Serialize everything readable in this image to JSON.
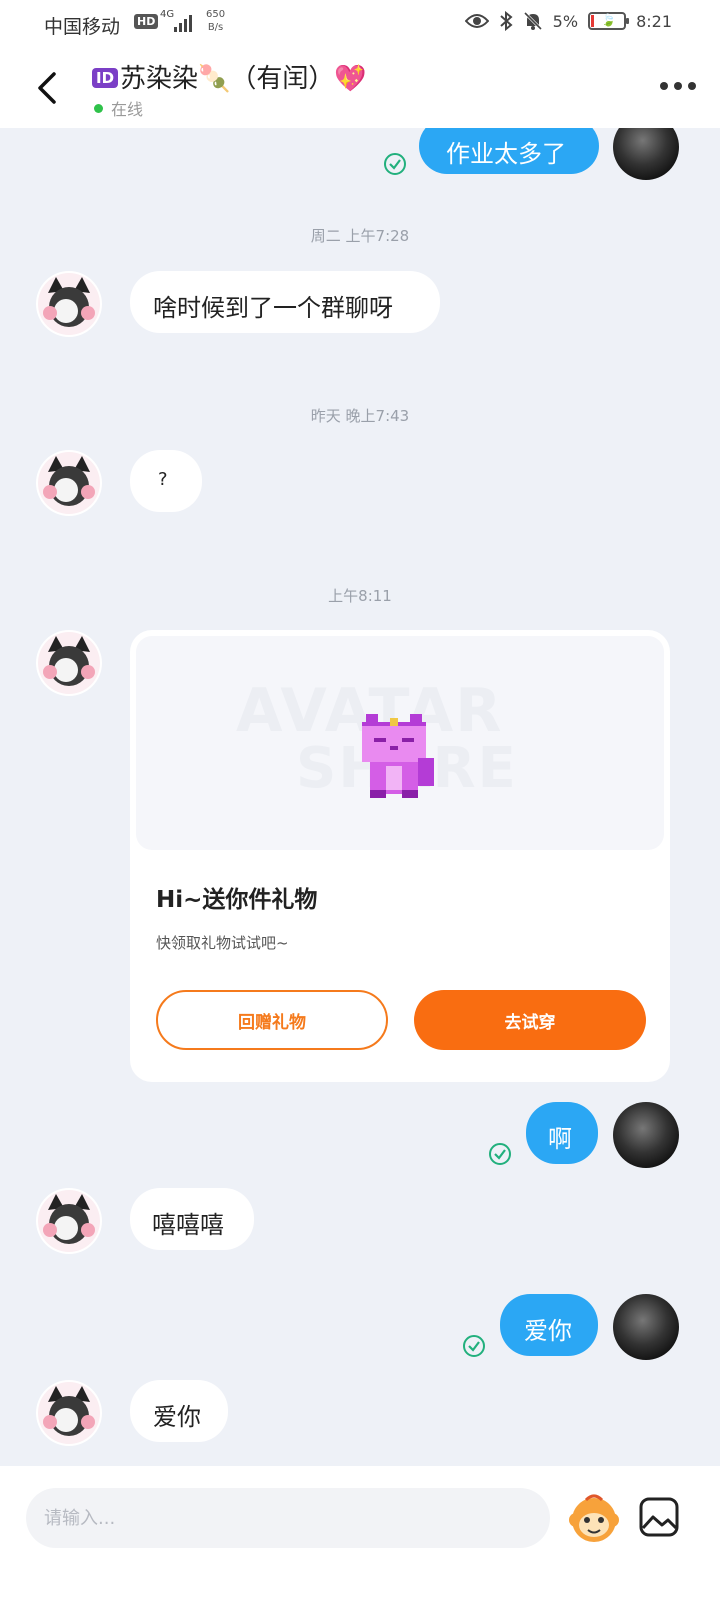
{
  "status_bar": {
    "carrier": "中国移动",
    "hd": "HD",
    "network": "4G",
    "speed_value": "650",
    "speed_unit": "B/s",
    "battery": "5%",
    "time": "8:21"
  },
  "header": {
    "contact_name": "苏染染🍡（有闰）💖",
    "id_badge": "ID",
    "status": "在线"
  },
  "messages": [
    {
      "type": "out",
      "text": "作业太多了"
    },
    {
      "type": "time",
      "text": "周二 上午7:28"
    },
    {
      "type": "in",
      "text": "啥时候到了一个群聊呀"
    },
    {
      "type": "time",
      "text": "昨天 晚上7:43"
    },
    {
      "type": "in",
      "text": "?"
    },
    {
      "type": "time",
      "text": "上午8:11"
    },
    {
      "type": "out",
      "text": "啊"
    },
    {
      "type": "in",
      "text": "嘻嘻嘻"
    },
    {
      "type": "out",
      "text": "爱你"
    },
    {
      "type": "in",
      "text": "爱你"
    }
  ],
  "gift_card": {
    "title": "Hi~送你件礼物",
    "subtitle": "快领取礼物试试吧~",
    "return_button": "回赠礼物",
    "try_button": "去试穿",
    "watermark_line1": "AVATAR",
    "watermark_line2": "SHARE"
  },
  "input": {
    "placeholder": "请输入..."
  },
  "colors": {
    "accent_blue": "#2ba7f4",
    "accent_orange": "#f96d11",
    "read_check": "#22b07d",
    "online": "#2fc24a"
  }
}
